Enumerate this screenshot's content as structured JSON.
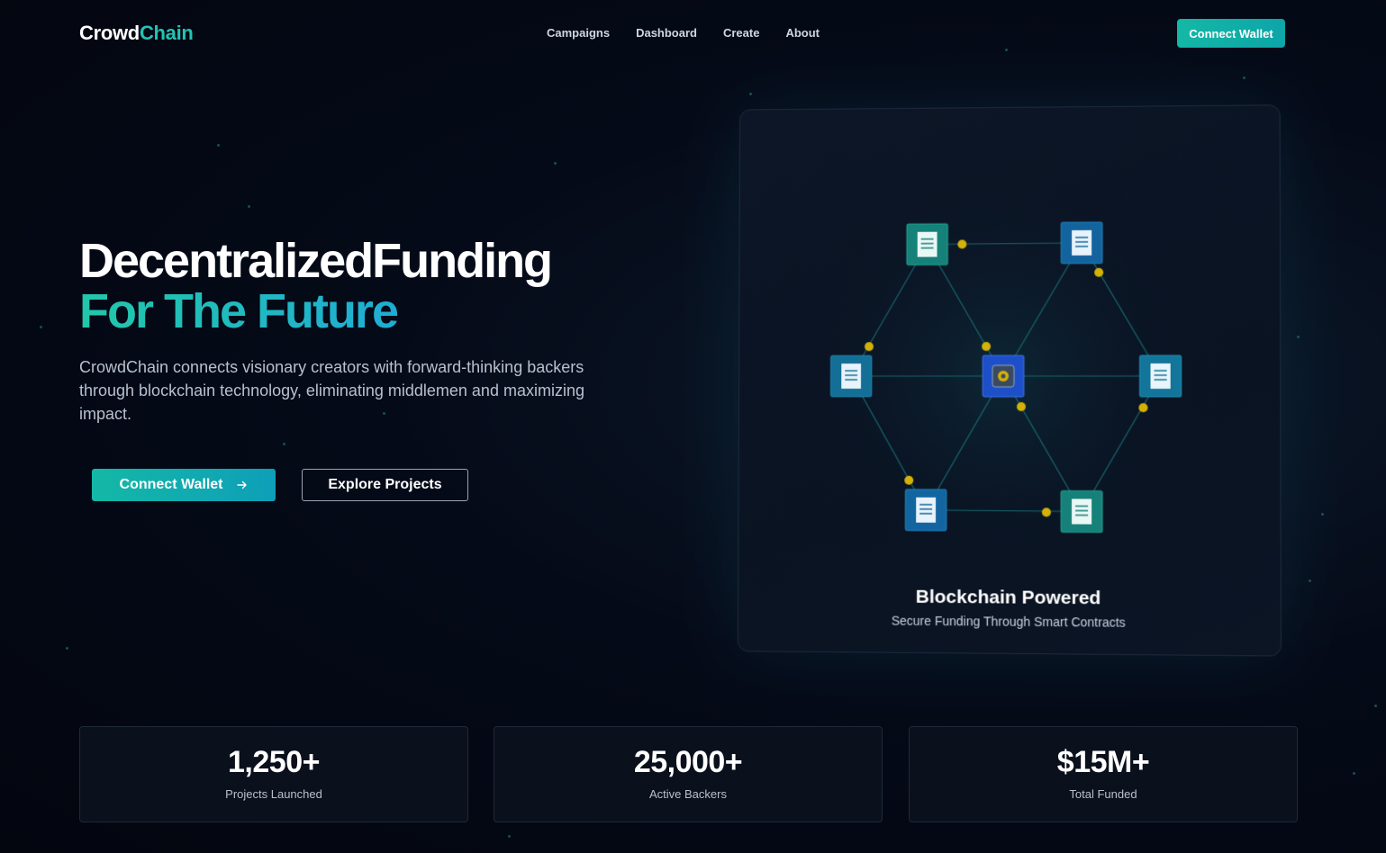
{
  "brand": {
    "name_part1": "Crowd",
    "name_part2": "Chain"
  },
  "nav": {
    "links": [
      "Campaigns",
      "Dashboard",
      "Create",
      "About"
    ],
    "connect_label": "Connect Wallet"
  },
  "hero": {
    "title_line1": "DecentralizedFunding",
    "title_line2": "For The Future",
    "description": "CrowdChain connects visionary creators with forward-thinking backers through blockchain technology, eliminating middlemen and maximizing impact.",
    "primary_label": "Connect Wallet",
    "primary_icon": "arrow-right-icon",
    "secondary_label": "Explore Projects"
  },
  "card": {
    "title": "Blockchain Powered",
    "subtitle": "Secure Funding Through Smart Contracts",
    "node_icons": [
      "document-icon",
      "document-icon",
      "document-icon",
      "document-icon",
      "document-icon",
      "document-icon",
      "vault-icon"
    ]
  },
  "stats": [
    {
      "value": "1,250+",
      "label": "Projects Launched"
    },
    {
      "value": "25,000+",
      "label": "Active Backers"
    },
    {
      "value": "$15M+",
      "label": "Total Funded"
    }
  ],
  "colors": {
    "accent": "#14b8a6",
    "accent_blue": "#1aa3e0",
    "node_dot": "#d4b106",
    "background": "#050a18"
  }
}
